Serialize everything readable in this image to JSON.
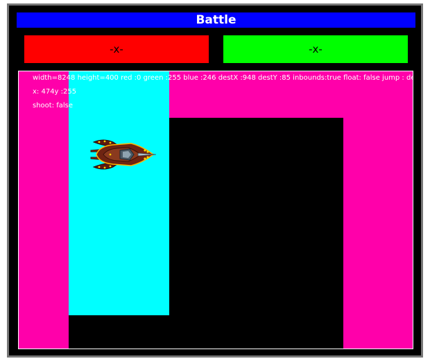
{
  "header": {
    "title": "Battle"
  },
  "scores": {
    "left": "-x-",
    "right": "-x-"
  },
  "colors": {
    "title_bar": "#0000ff",
    "left_box": "#ff0000",
    "right_box": "#00ff00",
    "stage_bg": "#ff00aa",
    "cyan_block": "#00ffff",
    "black_block": "#000000"
  },
  "debug": {
    "line1": "width=8248 height=400 red :0 green :255 blue :246 destX :948 destY :85 inbounds:true float: false jump : descend",
    "line2": "x: 474y :255",
    "line3": "shoot: false"
  },
  "sprite": {
    "icon": "spaceship-icon"
  }
}
